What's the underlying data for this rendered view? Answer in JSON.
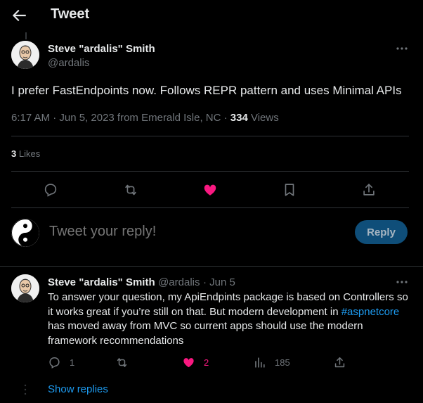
{
  "header": {
    "title": "Tweet"
  },
  "main_tweet": {
    "author_name": "Steve \"ardalis\" Smith",
    "author_handle": "@ardalis",
    "text": "I prefer FastEndpoints now. Follows REPR pattern and uses Minimal APIs",
    "meta_prefix": "6:17 AM · Jun 5, 2023 from Emerald Isle, NC · ",
    "views_count": "334",
    "views_label": " Views",
    "likes_count": "3",
    "likes_label": " Likes",
    "actions": [
      "reply-icon",
      "retweet-icon",
      "like-icon",
      "bookmark-icon",
      "share-icon"
    ],
    "liked_color": "#f91880"
  },
  "reply_box": {
    "placeholder": "Tweet your reply!",
    "button_label": "Reply"
  },
  "reply_tweet": {
    "author_name": "Steve \"ardalis\" Smith",
    "author_handle": "@ardalis",
    "date": "· Jun 5",
    "text_part1": "To answer your question, my ApiEndpints package is based on Controllers so it works great if you’re still on that. But modern development in ",
    "hashtag": "#aspnetcore",
    "text_part2": " has moved away from MVC so current apps should use the modern framework recommendations",
    "reply_count": "1",
    "retweet_count": "",
    "like_count": "2",
    "views_count": "185",
    "show_replies": "Show replies"
  },
  "colors": {
    "background": "#000000",
    "text": "#e7e9ea",
    "muted": "#71767b",
    "accent": "#1d9bf0",
    "like": "#f91880",
    "divider": "#2f3336"
  }
}
